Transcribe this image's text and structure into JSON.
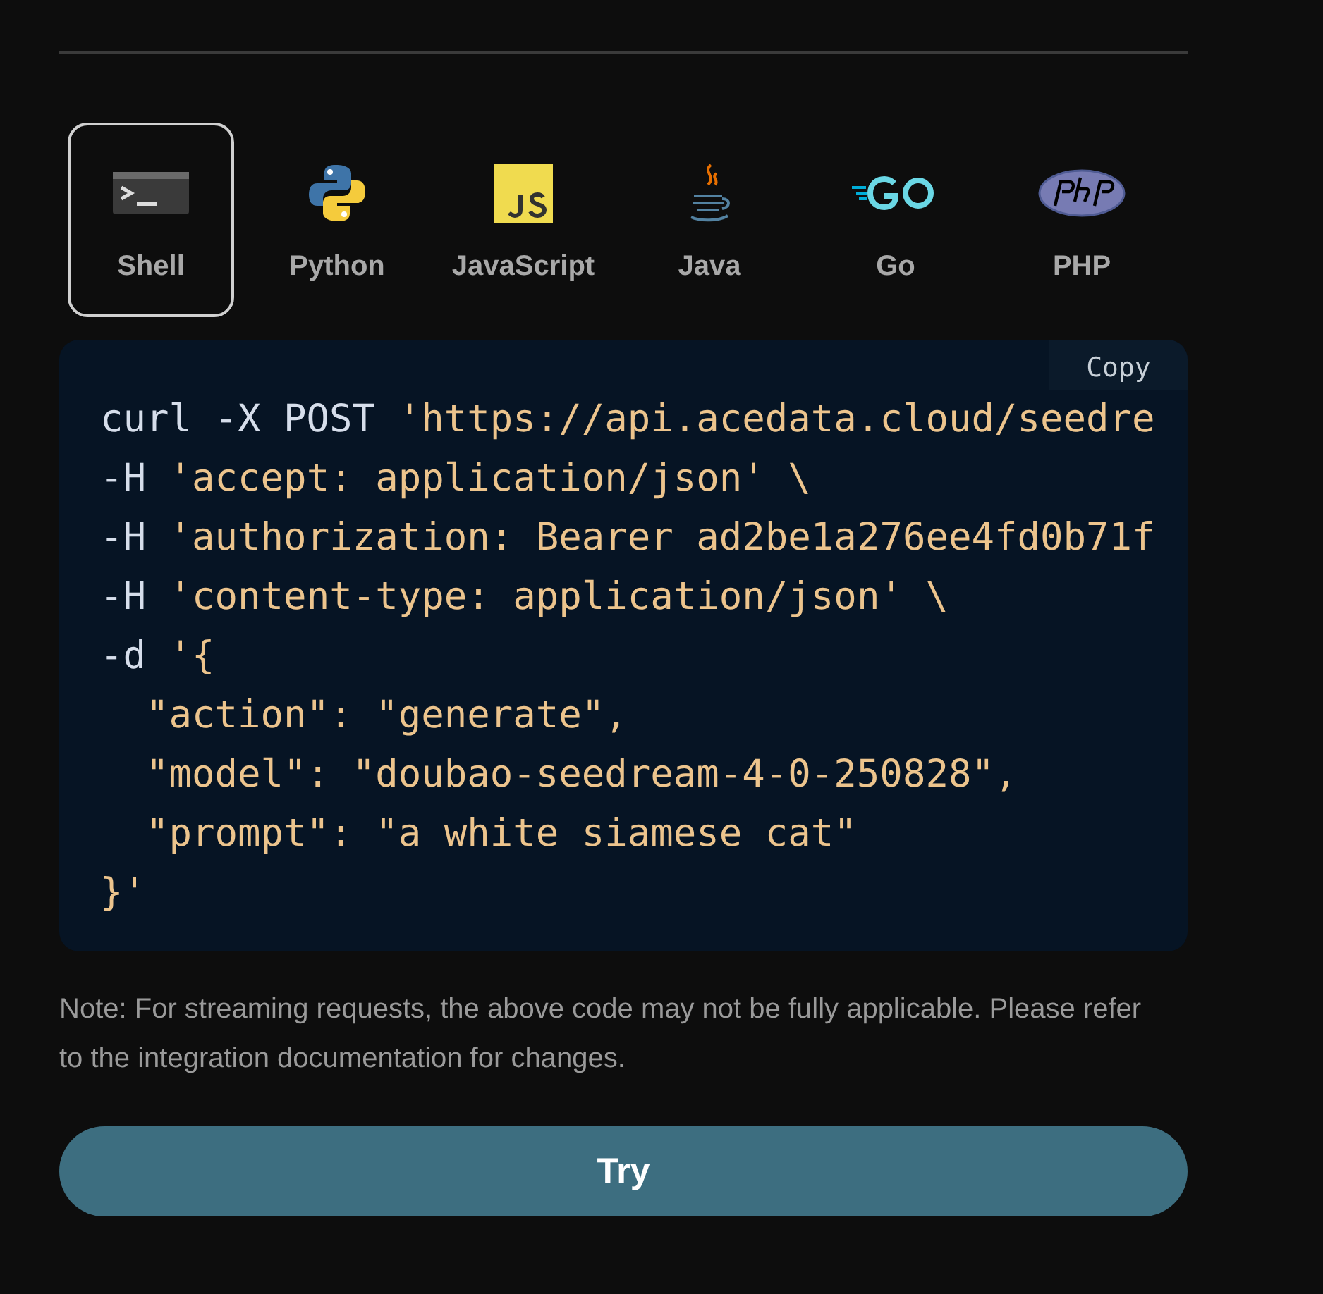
{
  "tabs": [
    {
      "label": "Shell",
      "kind": "shell",
      "selected": true
    },
    {
      "label": "Python",
      "kind": "python",
      "selected": false
    },
    {
      "label": "JavaScript",
      "kind": "javascript",
      "selected": false
    },
    {
      "label": "Java",
      "kind": "java",
      "selected": false
    },
    {
      "label": "Go",
      "kind": "go",
      "selected": false
    },
    {
      "label": "PHP",
      "kind": "php",
      "selected": false
    }
  ],
  "code": {
    "copy_label": "Copy",
    "lines": [
      [
        {
          "kind": "plain",
          "text": "curl -X POST "
        },
        {
          "kind": "string",
          "text": "'https://api.acedata.cloud/seedre"
        }
      ],
      [
        {
          "kind": "plain",
          "text": "-H "
        },
        {
          "kind": "string",
          "text": "'accept: application/json' \\"
        }
      ],
      [
        {
          "kind": "plain",
          "text": "-H "
        },
        {
          "kind": "string",
          "text": "'authorization: Bearer ad2be1a276ee4fd0b71f"
        }
      ],
      [
        {
          "kind": "plain",
          "text": "-H "
        },
        {
          "kind": "string",
          "text": "'content-type: application/json' \\"
        }
      ],
      [
        {
          "kind": "plain",
          "text": "-d "
        },
        {
          "kind": "string",
          "text": "'{"
        }
      ],
      [
        {
          "kind": "string",
          "text": "  \"action\": \"generate\","
        }
      ],
      [
        {
          "kind": "string",
          "text": "  \"model\": \"doubao-seedream-4-0-250828\","
        }
      ],
      [
        {
          "kind": "string",
          "text": "  \"prompt\": \"a white siamese cat\""
        }
      ],
      [
        {
          "kind": "string",
          "text": "}'"
        }
      ]
    ]
  },
  "note": "Note: For streaming requests, the above code may not be fully applicable. Please refer to the integration documentation for changes.",
  "try_button": "Try"
}
